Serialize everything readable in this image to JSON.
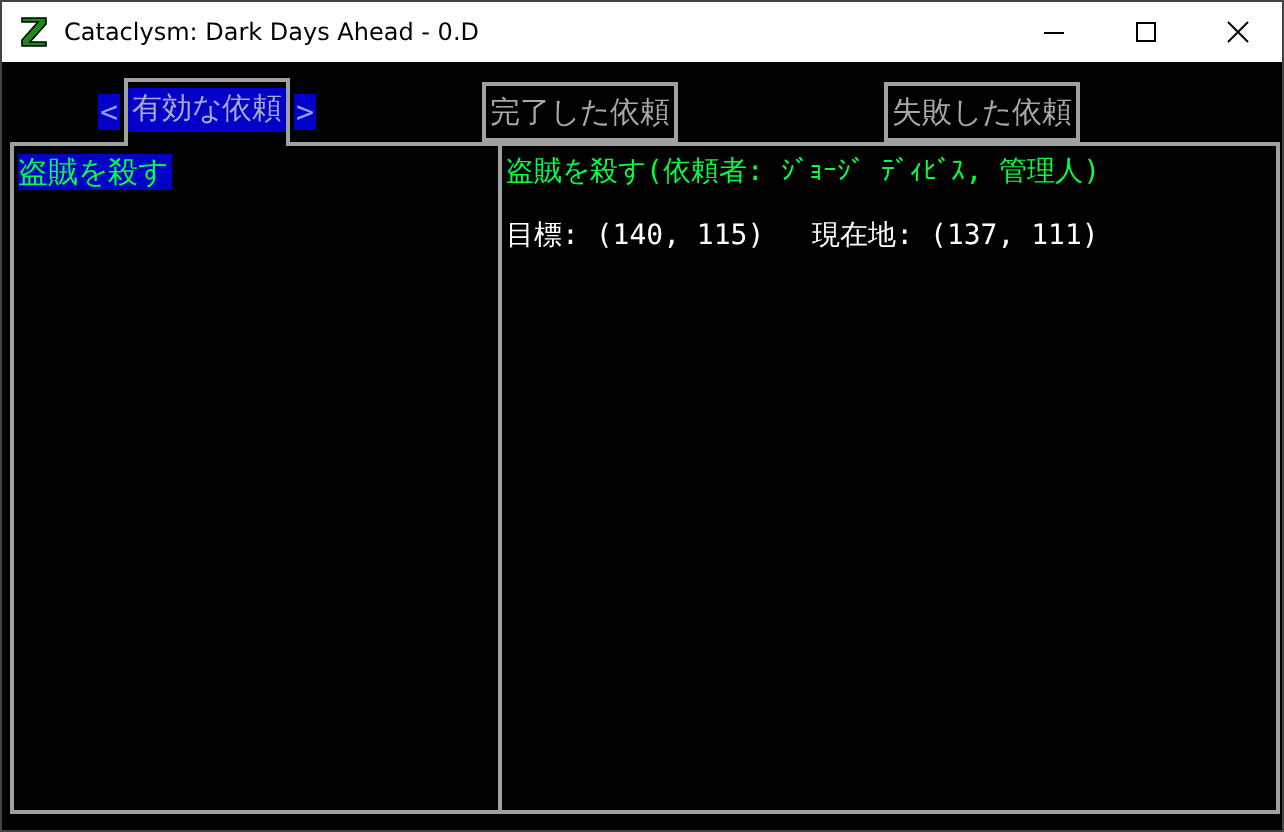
{
  "window": {
    "title": "Cataclysm: Dark Days Ahead - 0.D"
  },
  "tab_nav": {
    "prev": "<",
    "next": ">"
  },
  "tabs": [
    {
      "label": "有効な依頼",
      "selected": true
    },
    {
      "label": "完了した依頼",
      "selected": false
    },
    {
      "label": "失敗した依頼",
      "selected": false
    }
  ],
  "missions": [
    {
      "label": "盗賊を殺す",
      "selected": true
    }
  ],
  "detail": {
    "heading": "盗賊を殺す(依頼者: ｼﾞｮｰｼﾞ ﾃﾞｨﾋﾞｽ, 管理人)",
    "target": "目標: (140, 115)",
    "location": "現在地: (137, 111)"
  }
}
